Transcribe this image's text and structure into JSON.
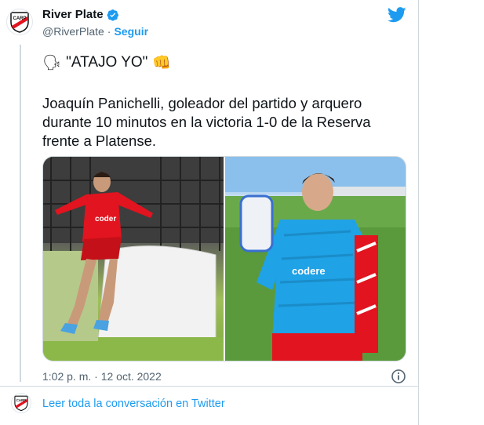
{
  "account": {
    "name": "River Plate",
    "handle": "@RiverPlate",
    "separator": "·",
    "follow_label": "Seguir"
  },
  "tweet": {
    "line1_emoji_left": "🗣",
    "line1_text": "\"ATAJO YO\"",
    "line1_emoji_right": "👊",
    "body": "Joaquín Panichelli, goleador del partido y arquero durante 10 minutos en la victoria 1-0 de la Reserva frente a Platense."
  },
  "media": {
    "left_photo_text": "coder",
    "right_photo_text": "codere"
  },
  "timestamp": "1:02 p. m. · 12 oct. 2022",
  "footer": {
    "read_more_label": "Leer toda la conversación en Twitter"
  },
  "colors": {
    "accent": "#1d9bf0",
    "text": "#0f1419",
    "muted": "#536471",
    "club_red": "#e1141f"
  },
  "icons": {
    "avatar": "river-plate-crest-icon",
    "verified": "verified-badge-icon",
    "platform": "twitter-bird-icon",
    "info": "info-icon"
  }
}
